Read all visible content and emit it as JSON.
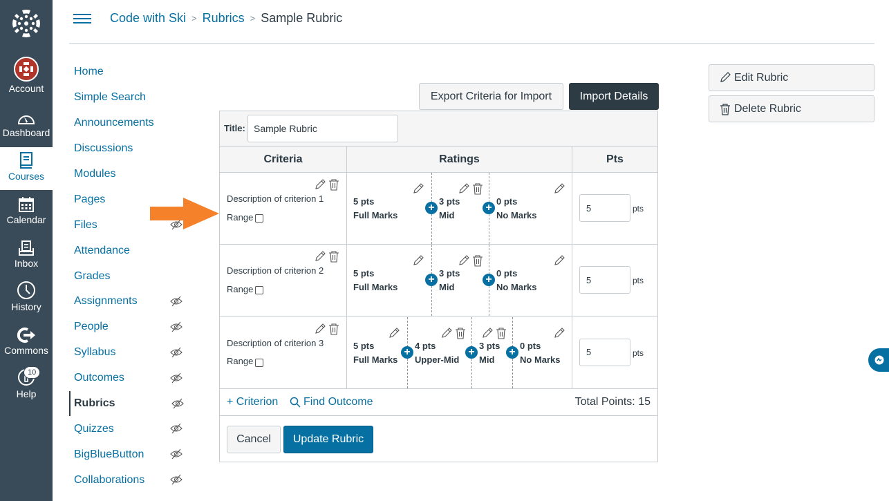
{
  "global_nav": {
    "items": [
      {
        "label": "Account",
        "icon": "account-avatar"
      },
      {
        "label": "Dashboard",
        "icon": "dashboard-icon"
      },
      {
        "label": "Courses",
        "icon": "courses-icon",
        "active": true
      },
      {
        "label": "Calendar",
        "icon": "calendar-icon"
      },
      {
        "label": "Inbox",
        "icon": "inbox-icon"
      },
      {
        "label": "History",
        "icon": "history-icon"
      },
      {
        "label": "Commons",
        "icon": "commons-icon"
      },
      {
        "label": "Help",
        "icon": "help-icon",
        "badge": "10"
      }
    ]
  },
  "breadcrumb": {
    "items": [
      "Code with Ski",
      "Rubrics"
    ],
    "current": "Sample Rubric"
  },
  "course_nav": {
    "items": [
      {
        "label": "Home",
        "hidden": false
      },
      {
        "label": "Simple Search",
        "hidden": false
      },
      {
        "label": "Announcements",
        "hidden": false
      },
      {
        "label": "Discussions",
        "hidden": false
      },
      {
        "label": "Modules",
        "hidden": false
      },
      {
        "label": "Pages",
        "hidden": false
      },
      {
        "label": "Files",
        "hidden": true
      },
      {
        "label": "Attendance",
        "hidden": false
      },
      {
        "label": "Grades",
        "hidden": false
      },
      {
        "label": "Assignments",
        "hidden": true
      },
      {
        "label": "People",
        "hidden": true
      },
      {
        "label": "Syllabus",
        "hidden": true
      },
      {
        "label": "Outcomes",
        "hidden": true
      },
      {
        "label": "Rubrics",
        "hidden": true,
        "active": true
      },
      {
        "label": "Quizzes",
        "hidden": true
      },
      {
        "label": "BigBlueButton",
        "hidden": true
      },
      {
        "label": "Collaborations",
        "hidden": true
      }
    ]
  },
  "toolbar": {
    "export_label": "Export Criteria for Import",
    "import_label": "Import Details"
  },
  "rubric": {
    "title_label": "Title:",
    "title_value": "Sample Rubric",
    "headers": {
      "criteria": "Criteria",
      "ratings": "Ratings",
      "pts": "Pts"
    },
    "range_label": "Range",
    "pts_suffix": "pts",
    "criteria": [
      {
        "description": "Description of criterion 1",
        "points": "5",
        "ratings": [
          {
            "pts": "5 pts",
            "label": "Full Marks"
          },
          {
            "pts": "3 pts",
            "label": "Mid"
          },
          {
            "pts": "0 pts",
            "label": "No Marks"
          }
        ]
      },
      {
        "description": "Description of criterion 2",
        "points": "5",
        "ratings": [
          {
            "pts": "5 pts",
            "label": "Full Marks"
          },
          {
            "pts": "3 pts",
            "label": "Mid"
          },
          {
            "pts": "0 pts",
            "label": "No Marks"
          }
        ]
      },
      {
        "description": "Description of criterion 3",
        "points": "5",
        "ratings": [
          {
            "pts": "5 pts",
            "label": "Full Marks"
          },
          {
            "pts": "4 pts",
            "label": "Upper-Mid"
          },
          {
            "pts": "3 pts",
            "label": "Mid"
          },
          {
            "pts": "0 pts",
            "label": "No Marks"
          }
        ]
      }
    ],
    "add_criterion_label": "Criterion",
    "find_outcome_label": "Find Outcome",
    "total_points_label": "Total Points: 15",
    "cancel_label": "Cancel",
    "update_label": "Update Rubric"
  },
  "side_actions": {
    "edit_label": "Edit Rubric",
    "delete_label": "Delete Rubric"
  },
  "colors": {
    "nav_bg": "#394b58",
    "link": "#0770a3",
    "dark_button": "#2d3b45",
    "primary_button": "#0770a3",
    "arrow": "#f5822a"
  }
}
